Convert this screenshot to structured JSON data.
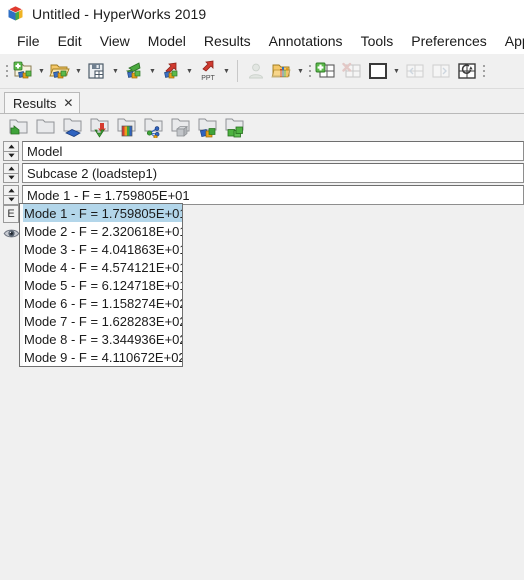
{
  "window": {
    "title": "Untitled - HyperWorks 2019",
    "logo_icon": "hyperworks-cube-icon"
  },
  "menubar": {
    "items": [
      {
        "label": "File",
        "name": "menu-file"
      },
      {
        "label": "Edit",
        "name": "menu-edit"
      },
      {
        "label": "View",
        "name": "menu-view"
      },
      {
        "label": "Model",
        "name": "menu-model"
      },
      {
        "label": "Results",
        "name": "menu-results"
      },
      {
        "label": "Annotations",
        "name": "menu-annotations"
      },
      {
        "label": "Tools",
        "name": "menu-tools"
      },
      {
        "label": "Preferences",
        "name": "menu-preferences"
      },
      {
        "label": "Applic",
        "name": "menu-applications"
      }
    ]
  },
  "toolbar": {
    "groups": [
      {
        "buttons": [
          {
            "name": "new-session-button",
            "icon": "new-session-icon",
            "dropdown": true
          },
          {
            "name": "open-model-button",
            "icon": "open-folder-icon",
            "dropdown": true
          },
          {
            "name": "save-session-button",
            "icon": "save-disk-icon",
            "dropdown": true
          },
          {
            "name": "import-button",
            "icon": "import-green-arrow-icon",
            "dropdown": true
          },
          {
            "name": "export-button",
            "icon": "export-red-arrow-icon",
            "dropdown": true
          },
          {
            "name": "export-ppt-button",
            "icon": "export-ppt-icon",
            "label": "PPT",
            "dropdown": true
          }
        ]
      },
      {
        "buttons": [
          {
            "name": "user-profile-button",
            "icon": "user-silhouette-icon",
            "disabled": true
          },
          {
            "name": "load-results-button",
            "icon": "open-results-chart-icon",
            "dropdown": true
          }
        ]
      },
      {
        "buttons": [
          {
            "name": "add-page-button",
            "icon": "add-page-icon"
          },
          {
            "name": "delete-page-button",
            "icon": "delete-page-icon",
            "disabled": true
          },
          {
            "name": "single-window-layout-button",
            "icon": "single-pane-layout-icon",
            "dropdown": true
          },
          {
            "name": "previous-page-button",
            "icon": "previous-page-icon",
            "disabled": true
          },
          {
            "name": "next-page-button",
            "icon": "next-page-icon",
            "disabled": true
          },
          {
            "name": "sync-views-button",
            "icon": "sync-views-icon"
          }
        ]
      }
    ]
  },
  "tab": {
    "label": "Results",
    "close_icon": "close-icon"
  },
  "panel_toolbar": {
    "buttons": [
      {
        "name": "open-folder-green-button",
        "icon": "folder-green-arrow-icon"
      },
      {
        "name": "folder-blank-button",
        "icon": "folder-blank-icon"
      },
      {
        "name": "contour-button",
        "icon": "contour-blue-plate-icon"
      },
      {
        "name": "import-result-button",
        "icon": "folder-red-arrow-down-icon"
      },
      {
        "name": "legend-button",
        "icon": "folder-color-legend-icon"
      },
      {
        "name": "vector-button",
        "icon": "folder-node-graph-icon"
      },
      {
        "name": "iso-surface-button",
        "icon": "folder-gray-cube-icon"
      },
      {
        "name": "section-cut-button",
        "icon": "folder-blue-blocks-icon"
      },
      {
        "name": "create-entity-button",
        "icon": "folder-green-blocks-icon"
      }
    ]
  },
  "results_panel": {
    "gutter": {
      "expand_button_label": "E",
      "expand_button_name": "expand-collapse-button",
      "visibility_icon": "eye-visibility-icon"
    },
    "selectors": [
      {
        "name": "model-selector",
        "value": "Model",
        "spinner_up_icon": "spinner-up-icon",
        "spinner_down_icon": "spinner-down-icon"
      },
      {
        "name": "subcase-selector",
        "value": "Subcase 2 (loadstep1)",
        "spinner_up_icon": "spinner-up-icon",
        "spinner_down_icon": "spinner-down-icon"
      },
      {
        "name": "simulation-selector",
        "value": "Mode 1 - F = 1.759805E+01",
        "spinner_up_icon": "spinner-up-icon",
        "spinner_down_icon": "spinner-down-icon"
      }
    ],
    "dropdown": {
      "name": "simulation-dropdown-list",
      "selected_index": 0,
      "items": [
        "Mode 1 - F = 1.759805E+01",
        "Mode 2 - F = 2.320618E+01",
        "Mode 3 - F = 4.041863E+01",
        "Mode 4 - F = 4.574121E+01",
        "Mode 5 - F = 6.124718E+01",
        "Mode 6 - F = 1.158274E+02",
        "Mode 7 - F = 1.628283E+02",
        "Mode 8 - F = 3.344936E+02",
        "Mode 9 - F = 4.110672E+02"
      ]
    }
  },
  "colors": {
    "selection_highlight": "#b3d6ea",
    "window_background": "#f0f0f0",
    "field_background": "#ffffff",
    "text": "#1b1b1b"
  }
}
